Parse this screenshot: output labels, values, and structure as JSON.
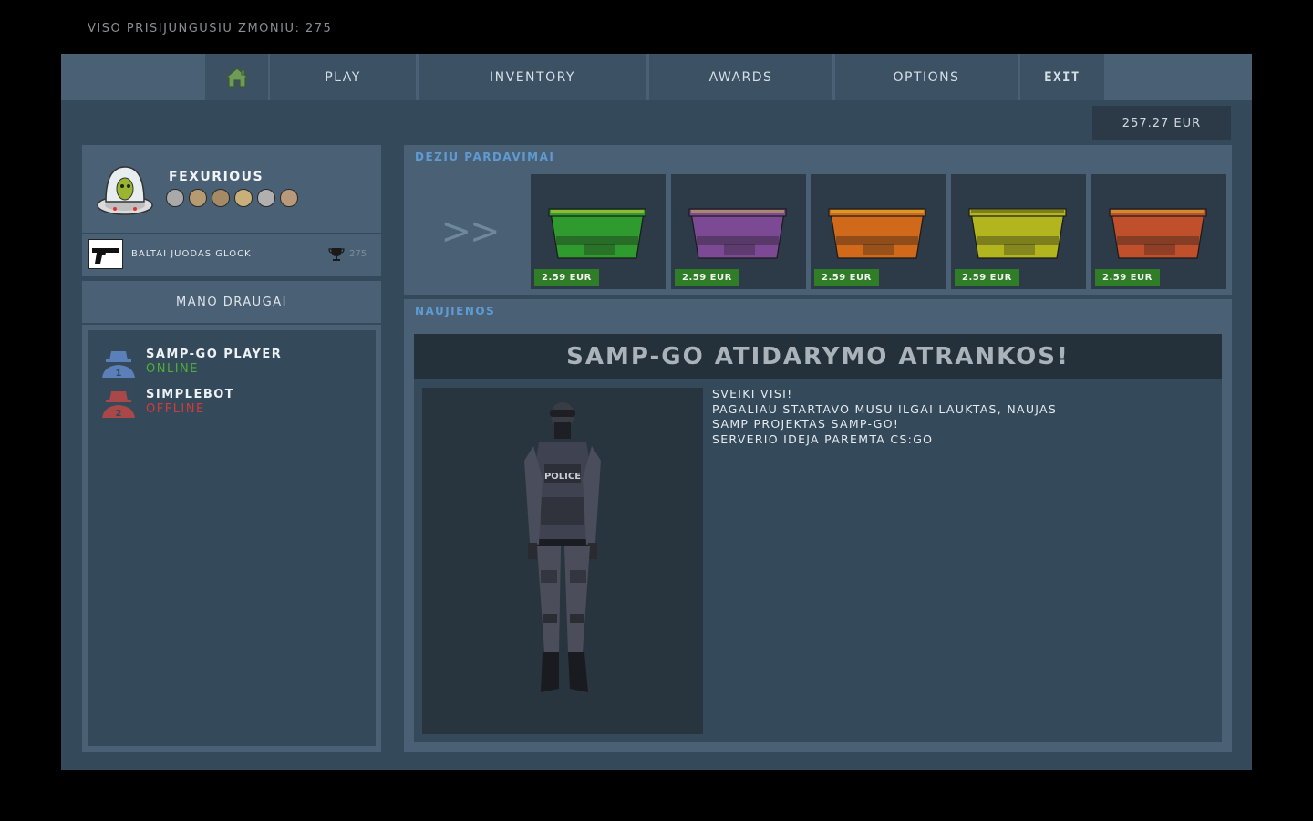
{
  "header": {
    "online_count_text": "VISO PRISIJUNGUSIU ZMONIU: 275"
  },
  "nav": {
    "home_icon": "home-icon",
    "play": "PLAY",
    "inventory": "INVENTORY",
    "awards": "AWARDS",
    "options": "OPTIONS",
    "exit": "EXIT"
  },
  "balance": "257.27 EUR",
  "profile": {
    "name": "FEXURIOUS",
    "medal_colors": [
      "#a9a9a9",
      "#b59a72",
      "#a58a66",
      "#c9b07a",
      "#b0b0b0",
      "#b89a7a"
    ]
  },
  "weapon": {
    "name": "BALTAI JUODAS GLOCK",
    "trophy_count": "275",
    "icon": "pistol-icon"
  },
  "friends": {
    "title": "MANO DRAUGAI",
    "list": [
      {
        "name": "SAMP-GO PLAYER",
        "status": "ONLINE",
        "status_color": "#4fae3a",
        "icon_color": "#5b7fb8"
      },
      {
        "name": "SIMPLEBOT",
        "status": "OFFLINE",
        "status_color": "#d33a3a",
        "icon_color": "#a84848"
      }
    ]
  },
  "boxes": {
    "title": "DEZIU PARDAVIMAI",
    "arrow": ">>",
    "items": [
      {
        "color": "#2f9a2e",
        "price": "2.59 EUR"
      },
      {
        "color": "#7c4a94",
        "price": "2.59 EUR"
      },
      {
        "color": "#d0691a",
        "price": "2.59 EUR"
      },
      {
        "color": "#b3b51f",
        "price": "2.59 EUR"
      },
      {
        "color": "#c0502c",
        "price": "2.59 EUR"
      }
    ]
  },
  "news": {
    "section_title": "NAUJIENOS",
    "headline": "SAMP-GO ATIDARYMO ATRANKOS!",
    "body": "SVEIKI VISI!\nPAGALIAU STARTAVO MUSU ILGAI LAUKTAS,  NAUJAS\nSAMP PROJEKTAS SAMP-GO!\nSERVERIO IDEJA PAREMTA CS:GO"
  }
}
